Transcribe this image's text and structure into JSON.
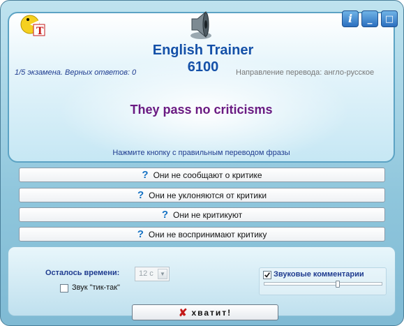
{
  "app": {
    "title": "English Trainer",
    "version": "6100"
  },
  "window_controls": {
    "info_label": "i",
    "minimize_label": "_",
    "restore_label": "□"
  },
  "status": {
    "exam_progress": "1/5 экзамена. Верных ответов: 0",
    "direction": "Направление перевода: англо-русское"
  },
  "question": {
    "phrase": "They pass no criticisms",
    "instruction": "Нажмите кнопку с правильным переводом фразы"
  },
  "answers": [
    {
      "label": "Они не сообщают о критике",
      "icon": "question-icon"
    },
    {
      "label": "Они не уклоняются от критики",
      "icon": "question-icon"
    },
    {
      "label": "Они не критикуют",
      "icon": "question-icon"
    },
    {
      "label": "Они не воспринимают критику",
      "icon": "question-icon"
    }
  ],
  "settings": {
    "time_left_label": "Осталось времени:",
    "time_value": "12 с",
    "tick_tock_label": "Звук \"тик-так\"",
    "tick_tock_checked": false,
    "sound_comments_label": "Звуковые комментарии",
    "sound_comments_checked": true,
    "volume_level": 0.63
  },
  "actions": {
    "enough_label": "хватит!"
  },
  "colors": {
    "accent": "#1450a8",
    "phrase": "#6a1a82",
    "question_mark": "#1572c4",
    "close_x": "#c41a1a"
  }
}
